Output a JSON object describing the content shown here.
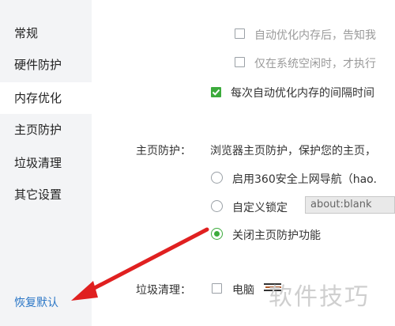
{
  "sidebar": {
    "items": [
      {
        "label": "常规"
      },
      {
        "label": "硬件防护"
      },
      {
        "label": "内存优化"
      },
      {
        "label": "主页防护"
      },
      {
        "label": "垃圾清理"
      },
      {
        "label": "其它设置"
      }
    ],
    "active_index": 2,
    "restore_label": "恢复默认"
  },
  "memory": {
    "opt1_label": "自动优化内存后，告知我",
    "opt2_label": "仅在系统空闲时，才执行",
    "opt3_label": "每次自动优化内存的间隔时间"
  },
  "homepage": {
    "section_label": "主页防护：",
    "description": "浏览器主页防护，保护您的主页，",
    "option1_label": "启用360安全上网导航（hao.",
    "option2_label": "自定义锁定",
    "custom_url_value": "about:blank",
    "option3_label": "关闭主页防护功能"
  },
  "junk": {
    "section_label": "垃圾清理：",
    "option_label": "电脑"
  },
  "watermark_text": "软件技巧",
  "colors": {
    "accent_green": "#3cab3c",
    "annotation_red": "#e02020",
    "link_blue": "#2a76c6"
  }
}
